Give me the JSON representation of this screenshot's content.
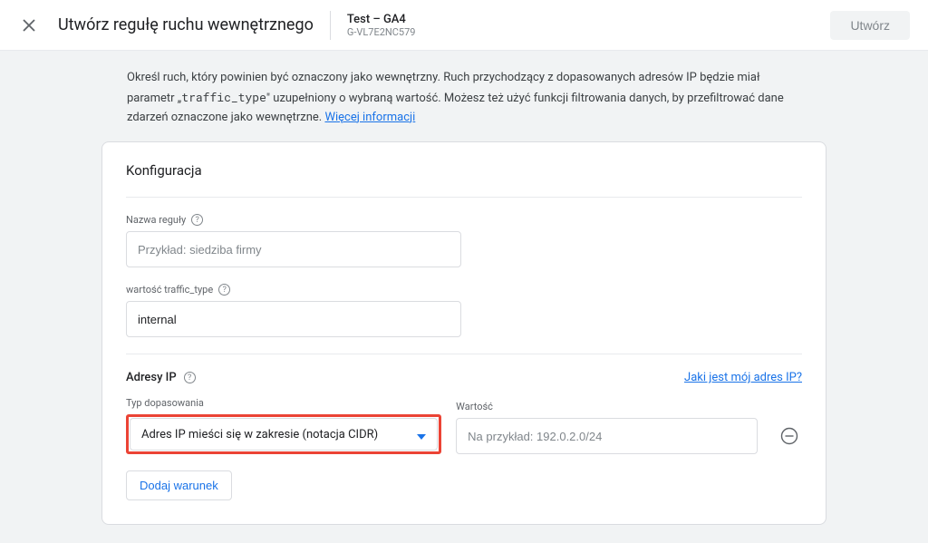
{
  "header": {
    "title": "Utwórz regułę ruchu wewnętrznego",
    "property_name": "Test – GA4",
    "property_id": "G-VL7E2NC579",
    "create_button": "Utwórz"
  },
  "description": {
    "part1": "Określ ruch, który powinien być oznaczony jako wewnętrzny. Ruch przychodzący z dopasowanych adresów IP będzie miał parametr „",
    "code": "traffic_type",
    "part2": "\" uzupełniony o wybraną wartość. Możesz też użyć funkcji filtrowania danych, by przefiltrować dane zdarzeń oznaczone jako wewnętrzne. ",
    "link": "Więcej informacji"
  },
  "config": {
    "section_title": "Konfiguracja",
    "rule_name_label": "Nazwa reguły",
    "rule_name_placeholder": "Przykład: siedziba firmy",
    "rule_name_value": "",
    "traffic_type_label": "wartość traffic_type",
    "traffic_type_value": "internal",
    "ip_section_title": "Adresy IP",
    "ip_help_link": "Jaki jest mój adres IP?",
    "match_type_label": "Typ dopasowania",
    "match_type_selected": "Adres IP mieści się w zakresie (notacja CIDR)",
    "value_label": "Wartość",
    "value_placeholder": "Na przykład: 192.0.2.0/24",
    "value_value": "",
    "add_condition": "Dodaj warunek"
  }
}
